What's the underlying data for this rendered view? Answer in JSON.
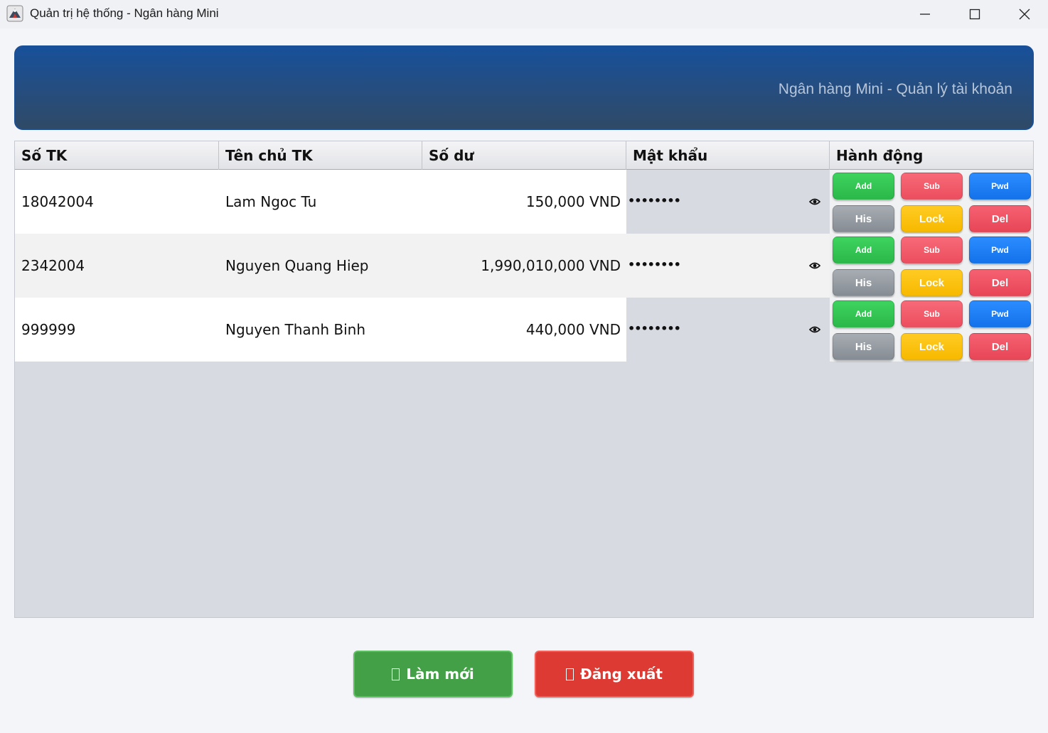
{
  "window": {
    "title": "Quản trị hệ thống - Ngân hàng Mini",
    "icon": "java-app-icon"
  },
  "banner": {
    "text": "Ngân hàng Mini - Quản lý tài khoản"
  },
  "table": {
    "headers": [
      "Số TK",
      "Tên chủ TK",
      "Số dư",
      "Mật khẩu",
      "Hành động"
    ],
    "rows": [
      {
        "account": "18042004",
        "owner": "Lam Ngoc Tu",
        "balance": "150,000 VND",
        "password": "••••••••"
      },
      {
        "account": "2342004",
        "owner": "Nguyen Quang Hiep",
        "balance": "1,990,010,000 VND",
        "password": "••••••••"
      },
      {
        "account": "999999",
        "owner": "Nguyen Thanh Binh",
        "balance": "440,000 VND",
        "password": "••••••••"
      }
    ],
    "actions": {
      "add": "Add",
      "sub": "Sub",
      "pwd": "Pwd",
      "his": "His",
      "lock": "Lock",
      "del": "Del"
    },
    "colors": {
      "add": "#2fbf50",
      "sub": "#f05a69",
      "pwd": "#1a7ef2",
      "his": "#959ba1",
      "lock": "#fbc10f",
      "del": "#ec4d5e"
    }
  },
  "footer": {
    "refresh_label": "Làm mới",
    "logout_label": "Đăng xuất",
    "refresh_color": "#43a047",
    "logout_color": "#dc3a33"
  }
}
